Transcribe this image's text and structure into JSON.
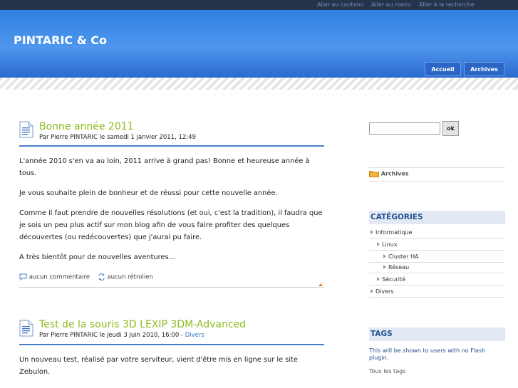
{
  "skip_links": [
    "Aller au contenu",
    "Aller au menu",
    "Aller à la recherche"
  ],
  "site": {
    "title": "PINTARIC & Co"
  },
  "nav": {
    "home": "Accueil",
    "archives": "Archives"
  },
  "posts": [
    {
      "title": "Bonne année 2011",
      "byline": "Par Pierre PINTARIC le samedi 1 janvier 2011, 12:49",
      "paragraphs": [
        "L'année 2010 s'en va au loin, 2011 arrive à grand pas! Bonne et heureuse année à tous.",
        "Je vous souhaite plein de bonheur et de réussi pour cette nouvelle année.",
        "Comme il faut prendre de nouvelles résolutions (et oui, c'est la tradition), il faudra que je sois un peu plus actif sur mon blog afin de vous faire profiter des quelques découvertes (ou redécouvertes) que j'aurai pu faire.",
        "A très bientôt pour de nouvelles aventures..."
      ],
      "comments": "aucun commentaire",
      "trackbacks": "aucun rétrolien"
    },
    {
      "title": "Test de la souris 3D LEXIP 3DM-Advanced",
      "byline": "Par Pierre PINTARIC le jeudi 3 juin 2010, 16:00 - ",
      "category": "Divers",
      "paragraphs": [
        "Un nouveau test, réalisé par votre serviteur, vient d'être mis en ligne sur le site Zebulon."
      ]
    }
  ],
  "sidebar": {
    "search_button": "ok",
    "archives": "Archives",
    "categories_title": "CATÉGORIES",
    "categories": [
      "Informatique",
      "Linux",
      "Cluster HA",
      "Réseau",
      "Sécurité",
      "Divers"
    ],
    "tags_title": "TAGS",
    "flash_note": "This will be shown to users with no Flash plugin.",
    "all_tags": "Tous les tags"
  },
  "colors": {
    "header": "#3d86e6",
    "title_green": "#8bbd1f",
    "link_blue": "#3a73c9"
  }
}
